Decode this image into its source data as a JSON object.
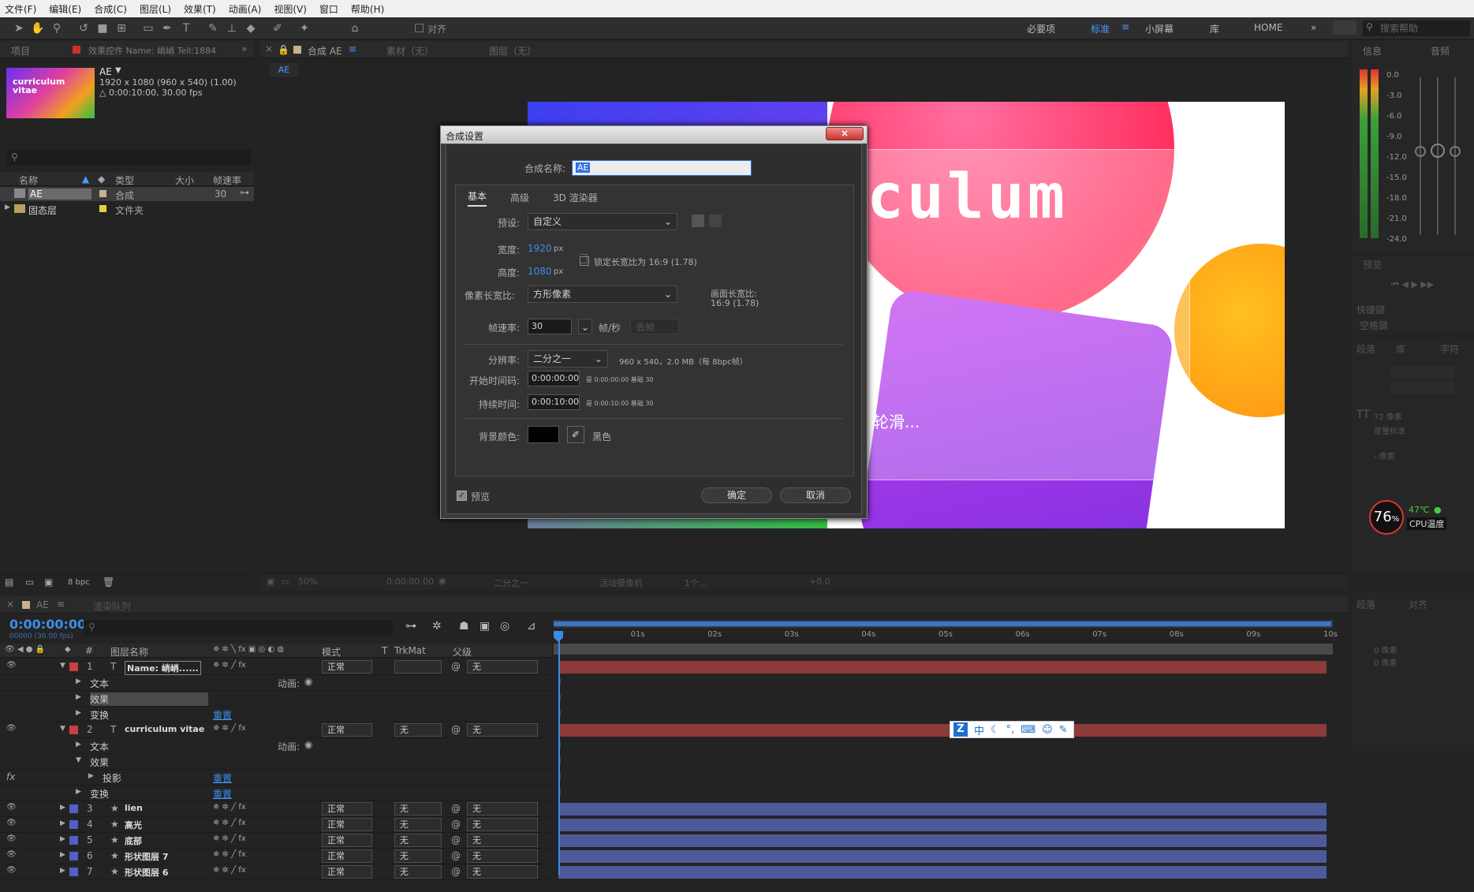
{
  "menu": [
    "文件(F)",
    "编辑(E)",
    "合成(C)",
    "图层(L)",
    "效果(T)",
    "动画(A)",
    "视图(V)",
    "窗口",
    "帮助(H)"
  ],
  "toolbar": {
    "align": "对齐",
    "workspaces": [
      "必要项",
      "标准",
      "小屏幕",
      "库",
      "HOME"
    ],
    "search_placeholder": "搜索帮助"
  },
  "project": {
    "tab_project": "项目",
    "tab_effects": "效果控件 Name: 峭峭 Tell:1884",
    "comp_name": "AE",
    "comp_info1": "1920 x 1080  (960 x 540) (1.00)",
    "comp_info2": "△ 0:00:10:00, 30.00 fps",
    "thumb_text": "curriculum vitae",
    "cols": [
      "名称",
      "类型",
      "大小",
      "帧速率"
    ],
    "items": [
      {
        "name": "AE",
        "type": "合成",
        "size": "",
        "fps": "30"
      },
      {
        "name": "固态层",
        "type": "文件夹",
        "size": "",
        "fps": ""
      }
    ],
    "bpc": "8 bpc"
  },
  "composition": {
    "tab": "合成 AE",
    "tab_footage": "素材（无）",
    "tab_layer": "图层（无）",
    "crumb": "AE",
    "big_text": "culum",
    "small_text": "轮滑...",
    "zoom": "50%",
    "timecode": "0:00:00:00",
    "res": "二分之一",
    "camera": "活动摄像机",
    "views": "1个...",
    "exposure": "+0.0"
  },
  "dialog": {
    "title": "合成设置",
    "name_label": "合成名称:",
    "name_value": "AE",
    "tabs": [
      "基本",
      "高级",
      "3D 渲染器"
    ],
    "preset_label": "预设:",
    "preset_value": "自定义",
    "width_label": "宽度:",
    "width_value": "1920",
    "px": "px",
    "height_label": "高度:",
    "height_value": "1080",
    "lock_label": "锁定长宽比为 16:9 (1.78)",
    "par_label": "像素长宽比:",
    "par_value": "方形像素",
    "frame_ar_label": "画面长宽比:",
    "frame_ar_value": "16:9 (1.78)",
    "fps_label": "帧速率:",
    "fps_value": "30",
    "fps_unit": "帧/秒",
    "drop": "丢帧",
    "res_label": "分辨率:",
    "res_value": "二分之一",
    "res_info": "960 x 540，2.0 MB（每 8bpc帧）",
    "start_label": "开始时间码:",
    "start_value": "0:00:00:00",
    "start_info": "是 0:00:00:00  基础 30",
    "dur_label": "持续时间:",
    "dur_value": "0:00:10:00",
    "dur_info": "是 0:00:10:00  基础 30",
    "bg_label": "背景颜色:",
    "bg_name": "黑色",
    "preview": "预览",
    "ok": "确定",
    "cancel": "取消"
  },
  "info": {
    "tab_info": "信息",
    "tab_audio": "音频",
    "db": [
      "0.0",
      "-3.0",
      "-6.0",
      "-9.0",
      "-12.0",
      "-15.0",
      "-18.0",
      "-21.0",
      "-24.0"
    ],
    "preview_tab": "预览",
    "shortcut": "快捷键",
    "space": "空格键",
    "para": "段落",
    "lib": "库",
    "char": "字符",
    "cpu_pct": "76",
    "cpu_unit": "%",
    "temp": "47℃",
    "cpu_label": "CPU温度",
    "px72": "72 像素",
    "aa": "度量标准",
    "pxx": "- 像素",
    "align_tab": "对齐",
    "px0": "0 像素"
  },
  "timeline": {
    "tab": "AE",
    "render": "渲染队列",
    "timecode": "0:00:00:00",
    "fps_sub": "00000 (30.00 fps)",
    "cols": [
      "#",
      "图层名称",
      "模式",
      "T",
      "TrkMat",
      "父级"
    ],
    "ticks": [
      "0s",
      "01s",
      "02s",
      "03s",
      "04s",
      "05s",
      "06s",
      "07s",
      "08s",
      "09s",
      "10s"
    ],
    "anim": "动画:",
    "reset": "重置",
    "rows": [
      {
        "type": "layer",
        "num": "1",
        "icon": "T",
        "name": "Name: 峭峭......",
        "mode": "正常",
        "trk": "",
        "parent": "无",
        "color": "#c84040"
      },
      {
        "type": "prop",
        "indent": 1,
        "name": "文本",
        "anim": true
      },
      {
        "type": "prop",
        "indent": 1,
        "name": "效果",
        "hl": true
      },
      {
        "type": "prop",
        "indent": 1,
        "name": "变换",
        "reset": true
      },
      {
        "type": "layer",
        "num": "2",
        "icon": "T",
        "name": "curriculum vitae",
        "mode": "正常",
        "trk": "无",
        "parent": "无",
        "color": "#c84040"
      },
      {
        "type": "prop",
        "indent": 1,
        "name": "文本",
        "anim": true
      },
      {
        "type": "prop",
        "indent": 1,
        "name": "效果",
        "open": true
      },
      {
        "type": "prop",
        "indent": 2,
        "name": "投影",
        "reset": true,
        "fx": true
      },
      {
        "type": "prop",
        "indent": 1,
        "name": "变换",
        "reset": true
      },
      {
        "type": "layer",
        "num": "3",
        "icon": "★",
        "name": "lien",
        "mode": "正常",
        "trk": "无",
        "parent": "无",
        "color": "#5060c8"
      },
      {
        "type": "layer",
        "num": "4",
        "icon": "★",
        "name": "高光",
        "mode": "正常",
        "trk": "无",
        "parent": "无",
        "color": "#5060c8"
      },
      {
        "type": "layer",
        "num": "5",
        "icon": "★",
        "name": "底部",
        "mode": "正常",
        "trk": "无",
        "parent": "无",
        "color": "#5060c8"
      },
      {
        "type": "layer",
        "num": "6",
        "icon": "★",
        "name": "形状图层 7",
        "mode": "正常",
        "trk": "无",
        "parent": "无",
        "color": "#5060c8"
      },
      {
        "type": "layer",
        "num": "7",
        "icon": "★",
        "name": "形状图层 6",
        "mode": "正常",
        "trk": "无",
        "parent": "无",
        "color": "#5060c8"
      }
    ]
  },
  "ime": {
    "zh": "中"
  }
}
